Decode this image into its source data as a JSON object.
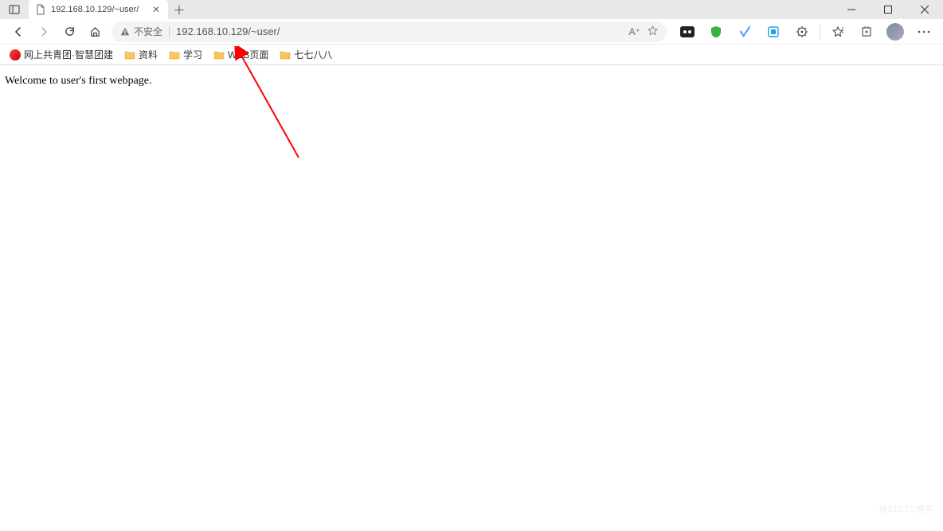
{
  "tab": {
    "title": "192.168.10.129/~user/"
  },
  "security_label": "不安全",
  "url": "192.168.10.129/~user/",
  "addr_right": {
    "reader": "A⁺"
  },
  "bookmarks": [
    {
      "label": "网上共青团·智慧团建",
      "icon": "red"
    },
    {
      "label": "资料",
      "icon": "folder"
    },
    {
      "label": "学习",
      "icon": "folder"
    },
    {
      "label": "WEB页面",
      "icon": "folder"
    },
    {
      "label": "七七八八",
      "icon": "folder"
    }
  ],
  "page_text": "Welcome to user's first webpage.",
  "watermark": "@51CTO博客"
}
